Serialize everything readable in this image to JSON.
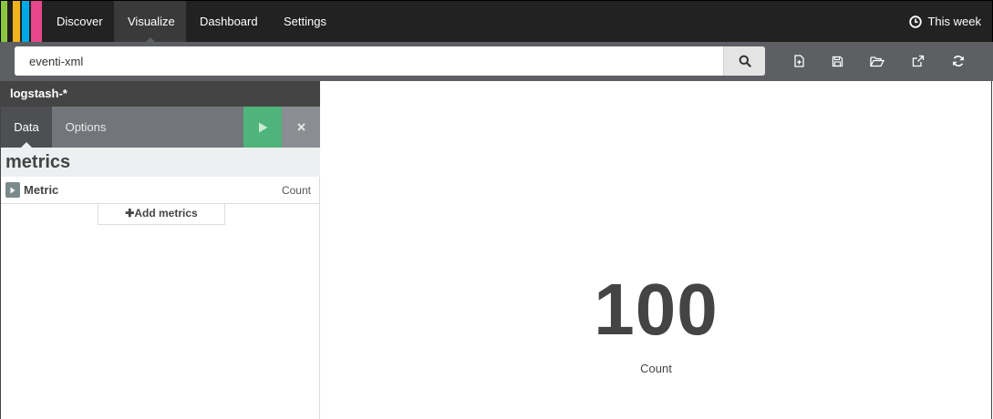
{
  "nav": {
    "logo_colors": [
      "#8cc63f",
      "#f0b21d",
      "#00a9e5",
      "#e8478b"
    ],
    "links": [
      "Discover",
      "Visualize",
      "Dashboard",
      "Settings"
    ],
    "active": "Visualize",
    "time_range": "This week",
    "time_icon": "clock-icon"
  },
  "search": {
    "value": "eventi-xml",
    "icon": "search-icon"
  },
  "toolbar_icons": [
    "new-visualization-icon",
    "save-icon",
    "open-icon",
    "share-icon",
    "refresh-icon"
  ],
  "sidebar": {
    "index_pattern": "logstash-*",
    "tabs": [
      "Data",
      "Options"
    ],
    "active_tab": "Data",
    "apply_icon": "play-icon",
    "discard_icon": "close-icon",
    "section_title": "metrics",
    "metric": {
      "label": "Metric",
      "type": "Count"
    },
    "add_metrics_label": "Add metrics"
  },
  "visualization": {
    "value": "100",
    "label": "Count"
  },
  "colors": {
    "nav_bg": "#222222",
    "toolbar_bg": "#5d5f63",
    "apply_green": "#4eb47a",
    "heading_bg": "#ecf0f1"
  }
}
